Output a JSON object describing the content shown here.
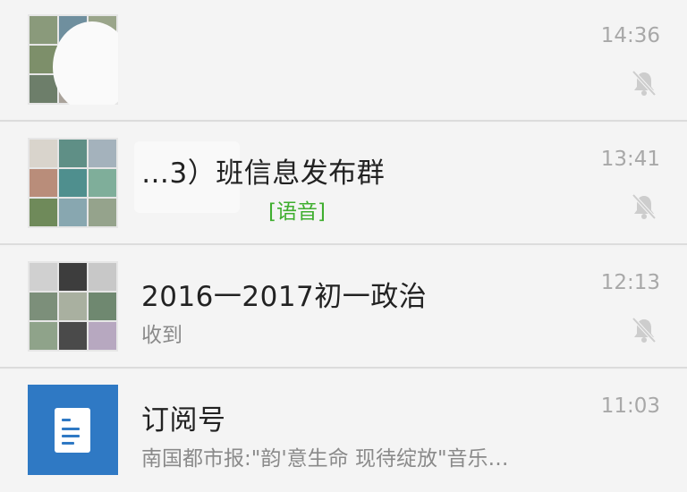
{
  "chats": [
    {
      "title": "",
      "subtitle": "",
      "time": "14:36",
      "muted": true,
      "avatar": "group-avatar-obscured"
    },
    {
      "title": "…3）班信息发布群",
      "subtitle_prefix": "",
      "subtitle_voice": "[语音]",
      "time": "13:41",
      "muted": true,
      "avatar": "group-avatar-grid"
    },
    {
      "title": "2016一2017初一政治",
      "subtitle": "收到",
      "time": "12:13",
      "muted": true,
      "avatar": "group-avatar-grid"
    },
    {
      "title": "订阅号",
      "subtitle": "南国都市报:\"韵'意生命 现待绽放\"音乐…",
      "time": "11:03",
      "muted": false,
      "avatar": "subscription-icon"
    }
  ],
  "colors": {
    "background": "#f4f4f4",
    "divider": "#dcdcdc",
    "title": "#222222",
    "subtitle": "#8a8a8a",
    "voice_tag": "#3fae2f",
    "time": "#a8a8a8",
    "subscription_blue": "#2f79c4"
  },
  "icons": {
    "mute": "bell-off-icon",
    "subscription": "document-icon"
  }
}
